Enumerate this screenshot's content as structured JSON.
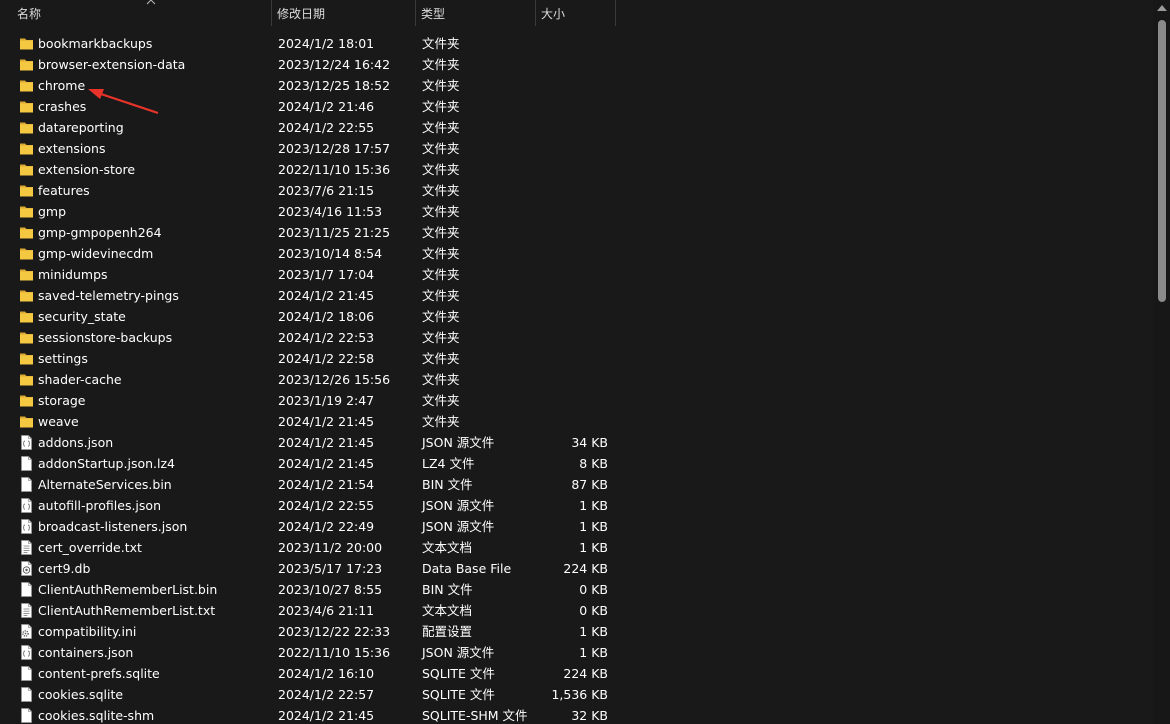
{
  "columns": {
    "name": "名称",
    "date": "修改日期",
    "type": "类型",
    "size": "大小"
  },
  "colors": {
    "background": "#191919",
    "folder_yellow": "#f5c842",
    "annotation_arrow": "#e8332a"
  },
  "files": [
    {
      "name": "bookmarkbackups",
      "date": "2024/1/2 18:01",
      "type": "文件夹",
      "size": "",
      "icon": "folder-icon"
    },
    {
      "name": "browser-extension-data",
      "date": "2023/12/24 16:42",
      "type": "文件夹",
      "size": "",
      "icon": "folder-icon"
    },
    {
      "name": "chrome",
      "date": "2023/12/25 18:52",
      "type": "文件夹",
      "size": "",
      "icon": "folder-icon"
    },
    {
      "name": "crashes",
      "date": "2024/1/2 21:46",
      "type": "文件夹",
      "size": "",
      "icon": "folder-icon"
    },
    {
      "name": "datareporting",
      "date": "2024/1/2 22:55",
      "type": "文件夹",
      "size": "",
      "icon": "folder-icon"
    },
    {
      "name": "extensions",
      "date": "2023/12/28 17:57",
      "type": "文件夹",
      "size": "",
      "icon": "folder-icon"
    },
    {
      "name": "extension-store",
      "date": "2022/11/10 15:36",
      "type": "文件夹",
      "size": "",
      "icon": "folder-icon"
    },
    {
      "name": "features",
      "date": "2023/7/6 21:15",
      "type": "文件夹",
      "size": "",
      "icon": "folder-icon"
    },
    {
      "name": "gmp",
      "date": "2023/4/16 11:53",
      "type": "文件夹",
      "size": "",
      "icon": "folder-icon"
    },
    {
      "name": "gmp-gmpopenh264",
      "date": "2023/11/25 21:25",
      "type": "文件夹",
      "size": "",
      "icon": "folder-icon"
    },
    {
      "name": "gmp-widevinecdm",
      "date": "2023/10/14 8:54",
      "type": "文件夹",
      "size": "",
      "icon": "folder-icon"
    },
    {
      "name": "minidumps",
      "date": "2023/1/7 17:04",
      "type": "文件夹",
      "size": "",
      "icon": "folder-icon"
    },
    {
      "name": "saved-telemetry-pings",
      "date": "2024/1/2 21:45",
      "type": "文件夹",
      "size": "",
      "icon": "folder-icon"
    },
    {
      "name": "security_state",
      "date": "2024/1/2 18:06",
      "type": "文件夹",
      "size": "",
      "icon": "folder-icon"
    },
    {
      "name": "sessionstore-backups",
      "date": "2024/1/2 22:53",
      "type": "文件夹",
      "size": "",
      "icon": "folder-icon"
    },
    {
      "name": "settings",
      "date": "2024/1/2 22:58",
      "type": "文件夹",
      "size": "",
      "icon": "folder-icon"
    },
    {
      "name": "shader-cache",
      "date": "2023/12/26 15:56",
      "type": "文件夹",
      "size": "",
      "icon": "folder-icon"
    },
    {
      "name": "storage",
      "date": "2023/1/19 2:47",
      "type": "文件夹",
      "size": "",
      "icon": "folder-icon"
    },
    {
      "name": "weave",
      "date": "2024/1/2 21:45",
      "type": "文件夹",
      "size": "",
      "icon": "folder-icon"
    },
    {
      "name": "addons.json",
      "date": "2024/1/2 21:45",
      "type": "JSON 源文件",
      "size": "34 KB",
      "icon": "json-file-icon"
    },
    {
      "name": "addonStartup.json.lz4",
      "date": "2024/1/2 21:45",
      "type": "LZ4 文件",
      "size": "8 KB",
      "icon": "file-icon"
    },
    {
      "name": "AlternateServices.bin",
      "date": "2024/1/2 21:54",
      "type": "BIN 文件",
      "size": "87 KB",
      "icon": "file-icon"
    },
    {
      "name": "autofill-profiles.json",
      "date": "2024/1/2 22:55",
      "type": "JSON 源文件",
      "size": "1 KB",
      "icon": "json-file-icon"
    },
    {
      "name": "broadcast-listeners.json",
      "date": "2024/1/2 22:49",
      "type": "JSON 源文件",
      "size": "1 KB",
      "icon": "json-file-icon"
    },
    {
      "name": "cert_override.txt",
      "date": "2023/11/2 20:00",
      "type": "文本文档",
      "size": "1 KB",
      "icon": "text-file-icon"
    },
    {
      "name": "cert9.db",
      "date": "2023/5/17 17:23",
      "type": "Data Base File",
      "size": "224 KB",
      "icon": "database-file-icon"
    },
    {
      "name": "ClientAuthRememberList.bin",
      "date": "2023/10/27 8:55",
      "type": "BIN 文件",
      "size": "0 KB",
      "icon": "file-icon"
    },
    {
      "name": "ClientAuthRememberList.txt",
      "date": "2023/4/6 21:11",
      "type": "文本文档",
      "size": "0 KB",
      "icon": "text-file-icon"
    },
    {
      "name": "compatibility.ini",
      "date": "2023/12/22 22:33",
      "type": "配置设置",
      "size": "1 KB",
      "icon": "settings-file-icon"
    },
    {
      "name": "containers.json",
      "date": "2022/11/10 15:36",
      "type": "JSON 源文件",
      "size": "1 KB",
      "icon": "json-file-icon"
    },
    {
      "name": "content-prefs.sqlite",
      "date": "2024/1/2 16:10",
      "type": "SQLITE 文件",
      "size": "224 KB",
      "icon": "file-icon"
    },
    {
      "name": "cookies.sqlite",
      "date": "2024/1/2 22:57",
      "type": "SQLITE 文件",
      "size": "1,536 KB",
      "icon": "file-icon"
    },
    {
      "name": "cookies.sqlite-shm",
      "date": "2024/1/2 21:45",
      "type": "SQLITE-SHM 文件",
      "size": "32 KB",
      "icon": "file-icon"
    }
  ]
}
